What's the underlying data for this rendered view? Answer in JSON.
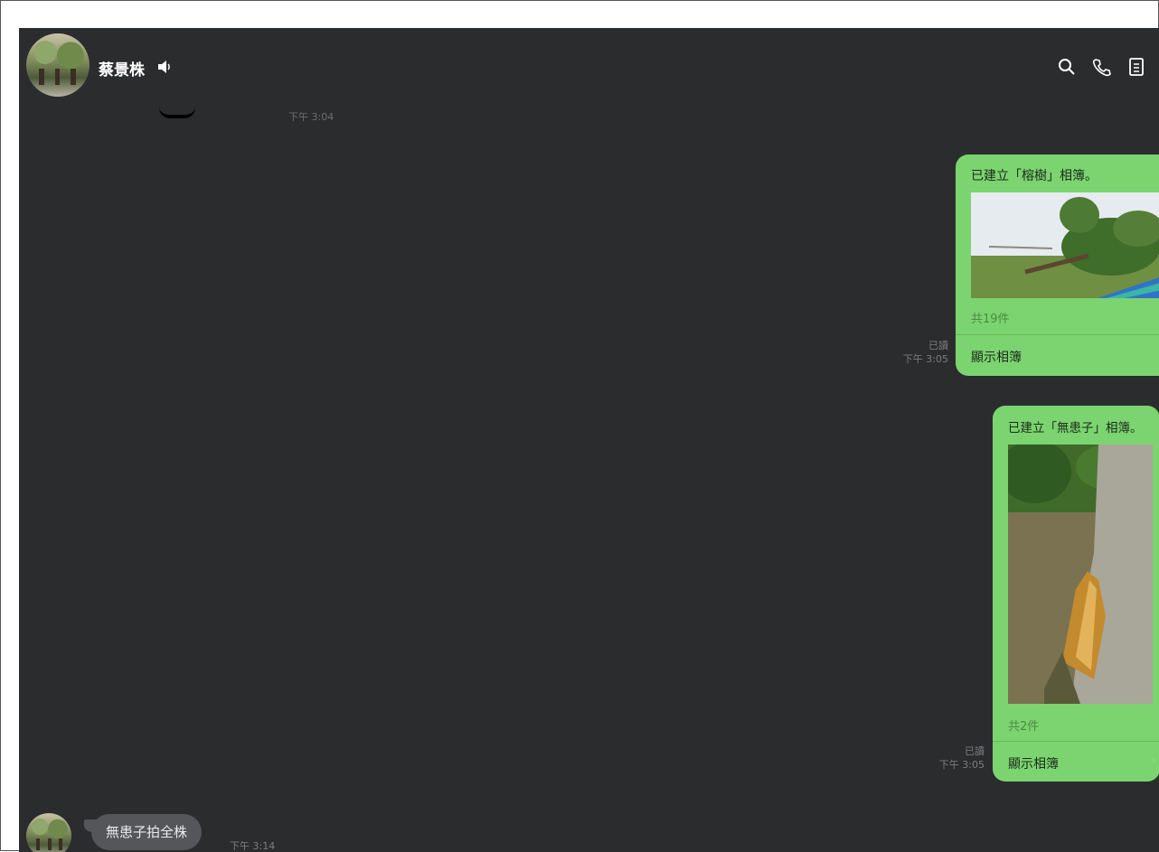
{
  "header": {
    "contact_name": "蔡景株",
    "icons": [
      "speaker-icon",
      "search-icon",
      "phone-icon",
      "notes-icon"
    ]
  },
  "messages": {
    "earlier_time": "下午 3:04",
    "album1": {
      "title": "已建立「榕樹」相簿。",
      "count": "共19件",
      "action": "顯示相簿",
      "read": "已讀",
      "time": "下午 3:05"
    },
    "album2": {
      "title": "已建立「無患子」相簿。",
      "count": "共2件",
      "action": "顯示相簿",
      "read": "已讀",
      "time": "下午 3:05"
    },
    "incoming": {
      "text": "無患子拍全株",
      "time": "下午 3:14"
    }
  },
  "colors": {
    "background": "#2b2c2e",
    "outgoing_bubble": "#7bd46f",
    "incoming_bubble": "#54565a"
  }
}
